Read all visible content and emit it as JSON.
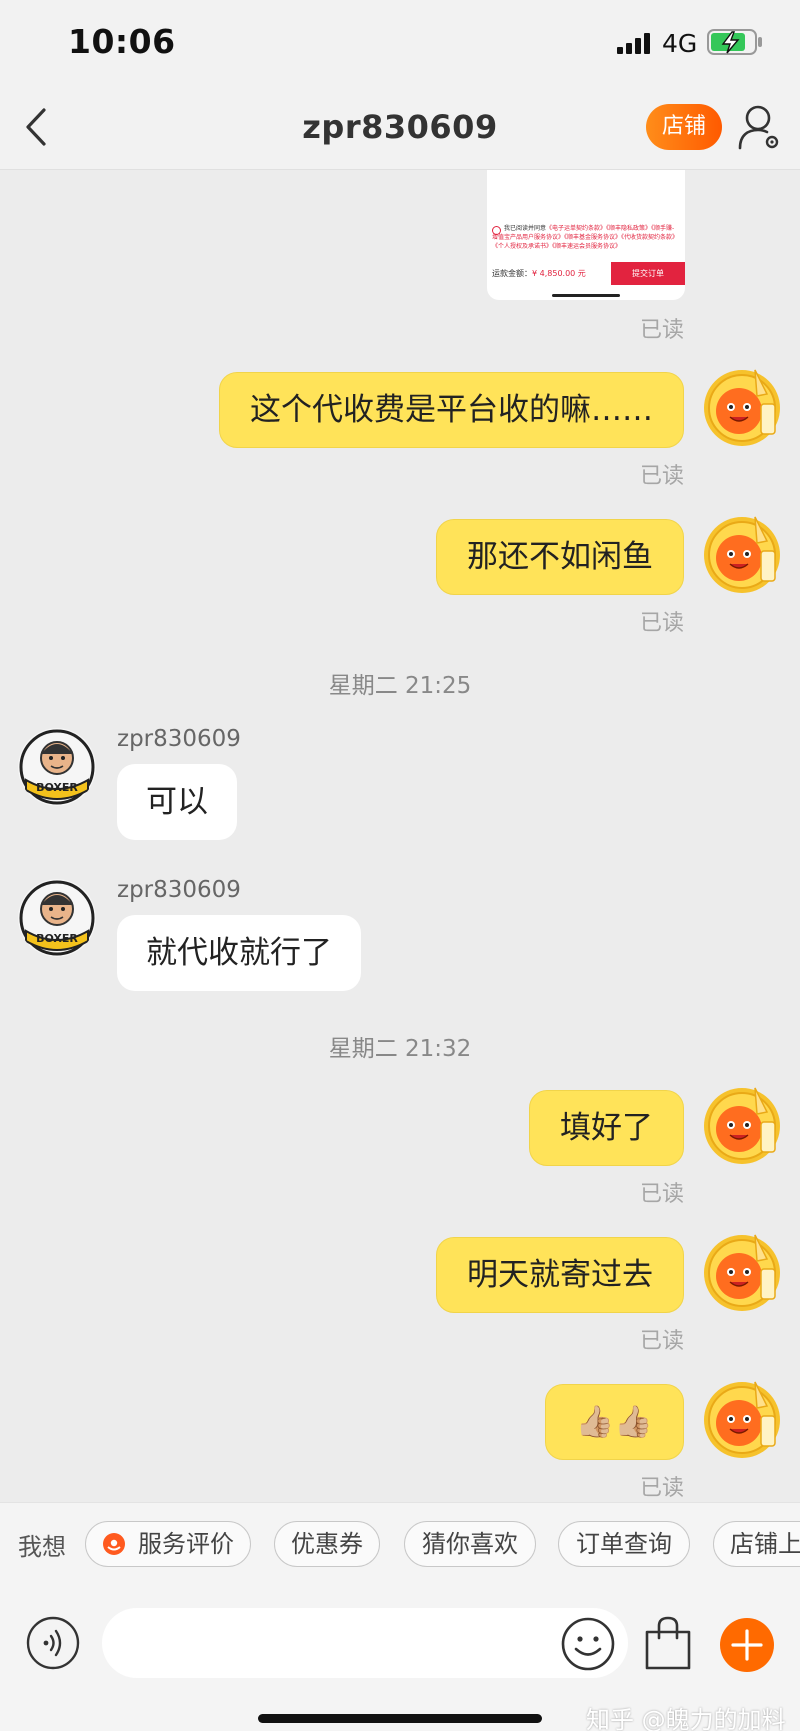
{
  "status_bar": {
    "time": "10:06",
    "network": "4G",
    "battery_color": "#34c759"
  },
  "nav": {
    "title": "zpr830609",
    "store_label": "店铺",
    "accent": "#ff6a00"
  },
  "order_card": {
    "terms_lead": "我已阅读并同意",
    "terms_links": "《电子运单契约条款》《顺丰隐私政策》《顺手赚-增值宝产品用户服务协议》《顺丰基金服务协议》《代收货款契约条款》《个人授权及承诺书》《顺丰速运会员服务协议》",
    "amount_label": "运款金额：",
    "amount_value": "¥ 4,850.00 元",
    "submit_label": "提交订单"
  },
  "messages": [
    {
      "id": "m0",
      "direction": "out",
      "read": "已读"
    },
    {
      "id": "m1",
      "direction": "out",
      "text": "这个代收费是平台收的嘛……",
      "read": "已读"
    },
    {
      "id": "m2",
      "direction": "out",
      "text": "那还不如闲鱼",
      "read": "已读"
    },
    {
      "id": "t1",
      "type": "time",
      "text": "星期二 21:25"
    },
    {
      "id": "m3",
      "direction": "in",
      "sender": "zpr830609",
      "text": "可以"
    },
    {
      "id": "m4",
      "direction": "in",
      "sender": "zpr830609",
      "text": "就代收就行了"
    },
    {
      "id": "t2",
      "type": "time",
      "text": "星期二 21:32"
    },
    {
      "id": "m5",
      "direction": "out",
      "text": "填好了",
      "read": "已读"
    },
    {
      "id": "m6",
      "direction": "out",
      "text": "明天就寄过去",
      "read": "已读"
    },
    {
      "id": "m7",
      "direction": "out",
      "text": "👍🏼👍🏼",
      "read": "已读"
    }
  ],
  "quick_bar": {
    "label": "我想",
    "chips": [
      "服务评价",
      "优惠券",
      "猜你喜欢",
      "订单查询",
      "店铺上新"
    ]
  },
  "input": {
    "placeholder": ""
  },
  "watermark": "知乎 @魄力的加料",
  "avatar_badge": "BOXER"
}
